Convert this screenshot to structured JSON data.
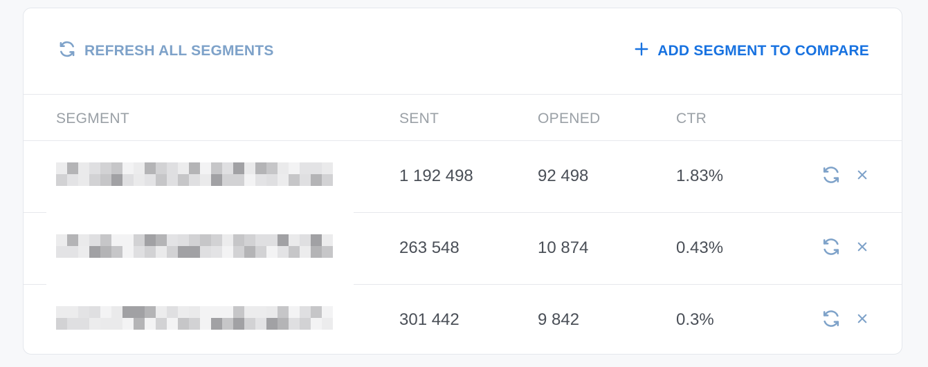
{
  "toolbar": {
    "refresh_all_label": "REFRESH ALL SEGMENTS",
    "add_segment_label": "ADD SEGMENT TO COMPARE"
  },
  "table": {
    "columns": [
      "SEGMENT",
      "SENT",
      "OPENED",
      "CTR"
    ],
    "rows": [
      {
        "segment": "",
        "sent": "1 192 498",
        "opened": "92 498",
        "ctr": "1.83%"
      },
      {
        "segment": "",
        "sent": "263 548",
        "opened": "10 874",
        "ctr": "0.43%"
      },
      {
        "segment": "",
        "sent": "301 442",
        "opened": "9 842",
        "ctr": "0.3%"
      }
    ]
  },
  "icons": {
    "refresh": "refresh-icon",
    "add": "plus-icon",
    "remove": "close-icon"
  },
  "colors": {
    "accent": "#1872e0",
    "muted_action": "#7ea2c9",
    "header_text": "#9aa0a6",
    "cell_text": "#4a4f57"
  }
}
